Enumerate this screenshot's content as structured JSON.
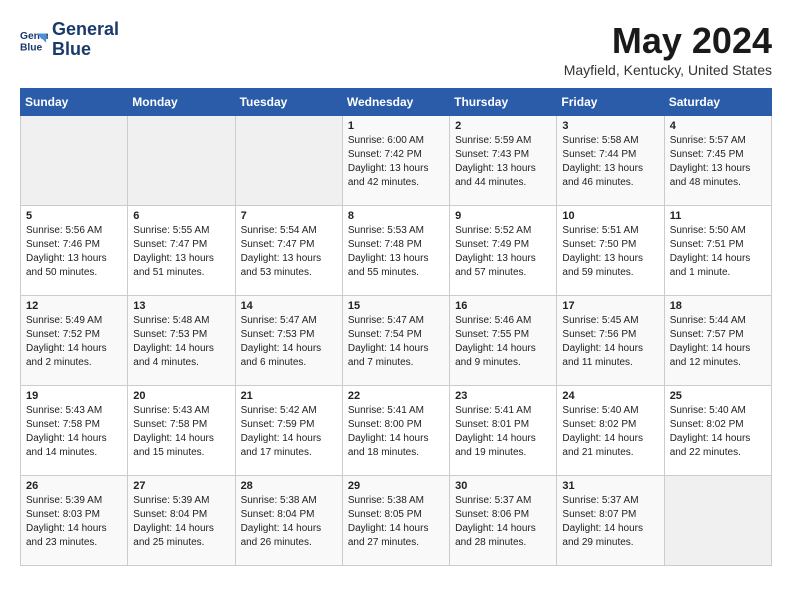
{
  "header": {
    "logo_line1": "General",
    "logo_line2": "Blue",
    "month": "May 2024",
    "location": "Mayfield, Kentucky, United States"
  },
  "days_of_week": [
    "Sunday",
    "Monday",
    "Tuesday",
    "Wednesday",
    "Thursday",
    "Friday",
    "Saturday"
  ],
  "weeks": [
    [
      {
        "day": "",
        "data": ""
      },
      {
        "day": "",
        "data": ""
      },
      {
        "day": "",
        "data": ""
      },
      {
        "day": "1",
        "data": "Sunrise: 6:00 AM\nSunset: 7:42 PM\nDaylight: 13 hours\nand 42 minutes."
      },
      {
        "day": "2",
        "data": "Sunrise: 5:59 AM\nSunset: 7:43 PM\nDaylight: 13 hours\nand 44 minutes."
      },
      {
        "day": "3",
        "data": "Sunrise: 5:58 AM\nSunset: 7:44 PM\nDaylight: 13 hours\nand 46 minutes."
      },
      {
        "day": "4",
        "data": "Sunrise: 5:57 AM\nSunset: 7:45 PM\nDaylight: 13 hours\nand 48 minutes."
      }
    ],
    [
      {
        "day": "5",
        "data": "Sunrise: 5:56 AM\nSunset: 7:46 PM\nDaylight: 13 hours\nand 50 minutes."
      },
      {
        "day": "6",
        "data": "Sunrise: 5:55 AM\nSunset: 7:47 PM\nDaylight: 13 hours\nand 51 minutes."
      },
      {
        "day": "7",
        "data": "Sunrise: 5:54 AM\nSunset: 7:47 PM\nDaylight: 13 hours\nand 53 minutes."
      },
      {
        "day": "8",
        "data": "Sunrise: 5:53 AM\nSunset: 7:48 PM\nDaylight: 13 hours\nand 55 minutes."
      },
      {
        "day": "9",
        "data": "Sunrise: 5:52 AM\nSunset: 7:49 PM\nDaylight: 13 hours\nand 57 minutes."
      },
      {
        "day": "10",
        "data": "Sunrise: 5:51 AM\nSunset: 7:50 PM\nDaylight: 13 hours\nand 59 minutes."
      },
      {
        "day": "11",
        "data": "Sunrise: 5:50 AM\nSunset: 7:51 PM\nDaylight: 14 hours\nand 1 minute."
      }
    ],
    [
      {
        "day": "12",
        "data": "Sunrise: 5:49 AM\nSunset: 7:52 PM\nDaylight: 14 hours\nand 2 minutes."
      },
      {
        "day": "13",
        "data": "Sunrise: 5:48 AM\nSunset: 7:53 PM\nDaylight: 14 hours\nand 4 minutes."
      },
      {
        "day": "14",
        "data": "Sunrise: 5:47 AM\nSunset: 7:53 PM\nDaylight: 14 hours\nand 6 minutes."
      },
      {
        "day": "15",
        "data": "Sunrise: 5:47 AM\nSunset: 7:54 PM\nDaylight: 14 hours\nand 7 minutes."
      },
      {
        "day": "16",
        "data": "Sunrise: 5:46 AM\nSunset: 7:55 PM\nDaylight: 14 hours\nand 9 minutes."
      },
      {
        "day": "17",
        "data": "Sunrise: 5:45 AM\nSunset: 7:56 PM\nDaylight: 14 hours\nand 11 minutes."
      },
      {
        "day": "18",
        "data": "Sunrise: 5:44 AM\nSunset: 7:57 PM\nDaylight: 14 hours\nand 12 minutes."
      }
    ],
    [
      {
        "day": "19",
        "data": "Sunrise: 5:43 AM\nSunset: 7:58 PM\nDaylight: 14 hours\nand 14 minutes."
      },
      {
        "day": "20",
        "data": "Sunrise: 5:43 AM\nSunset: 7:58 PM\nDaylight: 14 hours\nand 15 minutes."
      },
      {
        "day": "21",
        "data": "Sunrise: 5:42 AM\nSunset: 7:59 PM\nDaylight: 14 hours\nand 17 minutes."
      },
      {
        "day": "22",
        "data": "Sunrise: 5:41 AM\nSunset: 8:00 PM\nDaylight: 14 hours\nand 18 minutes."
      },
      {
        "day": "23",
        "data": "Sunrise: 5:41 AM\nSunset: 8:01 PM\nDaylight: 14 hours\nand 19 minutes."
      },
      {
        "day": "24",
        "data": "Sunrise: 5:40 AM\nSunset: 8:02 PM\nDaylight: 14 hours\nand 21 minutes."
      },
      {
        "day": "25",
        "data": "Sunrise: 5:40 AM\nSunset: 8:02 PM\nDaylight: 14 hours\nand 22 minutes."
      }
    ],
    [
      {
        "day": "26",
        "data": "Sunrise: 5:39 AM\nSunset: 8:03 PM\nDaylight: 14 hours\nand 23 minutes."
      },
      {
        "day": "27",
        "data": "Sunrise: 5:39 AM\nSunset: 8:04 PM\nDaylight: 14 hours\nand 25 minutes."
      },
      {
        "day": "28",
        "data": "Sunrise: 5:38 AM\nSunset: 8:04 PM\nDaylight: 14 hours\nand 26 minutes."
      },
      {
        "day": "29",
        "data": "Sunrise: 5:38 AM\nSunset: 8:05 PM\nDaylight: 14 hours\nand 27 minutes."
      },
      {
        "day": "30",
        "data": "Sunrise: 5:37 AM\nSunset: 8:06 PM\nDaylight: 14 hours\nand 28 minutes."
      },
      {
        "day": "31",
        "data": "Sunrise: 5:37 AM\nSunset: 8:07 PM\nDaylight: 14 hours\nand 29 minutes."
      },
      {
        "day": "",
        "data": ""
      }
    ]
  ]
}
